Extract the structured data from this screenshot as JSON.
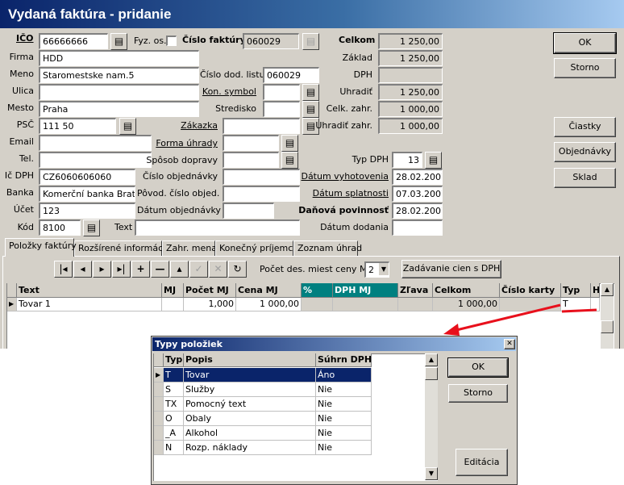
{
  "window": {
    "title": "Vydaná faktúra   -   pridanie"
  },
  "header": {
    "ico_label": "IČO",
    "ico_value": "66666666",
    "fyz_label": "Fyz. os.",
    "faktura_label": "Číslo faktúry",
    "faktura_value": "060029",
    "firma_label": "Firma",
    "firma_value": "HDD",
    "meno_label": "Meno",
    "meno_value": "Staromestske nam.5",
    "dod_list_label": "Číslo dod. listu",
    "dod_list_value": "060029",
    "ulica_label": "Ulica",
    "ulica_value": "",
    "kon_symbol_label": "Kon. symbol",
    "kon_symbol_value": "",
    "mesto_label": "Mesto",
    "mesto_value": "Praha",
    "stredisko_label": "Stredisko",
    "stredisko_value": "",
    "psc_label": "PSČ",
    "psc_value": "111 50",
    "zakazka_label": "Zákazka",
    "zakazka_value": "",
    "email_label": "Email",
    "email_value": "",
    "forma_label": "Forma úhrady",
    "forma_value": "",
    "tel_label": "Tel.",
    "tel_value": "",
    "doprava_label": "Spôsob dopravy",
    "doprava_value": "",
    "icdph_label": "Ič DPH",
    "icdph_value": "CZ6060606060",
    "obj_label": "Číslo objednávky",
    "obj_value": "",
    "banka_label": "Banka",
    "banka_value": "Komerční banka Bratisla",
    "povod_label": "Pôvod. číslo objed.",
    "povod_value": "",
    "ucet_label": "Účet",
    "ucet_value": "123",
    "datum_obj_label": "Dátum objednávky",
    "datum_obj_value": "",
    "kod_label": "Kód",
    "kod_value": "8100",
    "text_label": "Text",
    "text_value": ""
  },
  "totals": {
    "celkom_label": "Celkom",
    "celkom_value": "1 250,00",
    "zaklad_label": "Základ",
    "zaklad_value": "1 250,00",
    "dph_label": "DPH",
    "dph_value": "",
    "uhradit_label": "Uhradiť",
    "uhradit_value": "1 250,00",
    "celk_zahr_label": "Celk. zahr.",
    "celk_zahr_value": "1 000,00",
    "uhradit_zahr_label": "Uhradiť zahr.",
    "uhradit_zahr_value": "1 000,00",
    "typ_dph_label": "Typ DPH",
    "typ_dph_value": "13",
    "vyhotovenia_label": "Dátum vyhotovenia",
    "vyhotovenia_value": "28.02.2007",
    "splatnosti_label": "Dátum splatnosti",
    "splatnosti_value": "07.03.2007",
    "povinnost_label": "Daňová povinnosť",
    "povinnost_value": "28.02.2007",
    "dodania_label": "Dátum dodania",
    "dodania_value": ""
  },
  "side_buttons": {
    "ok": "OK",
    "storno": "Storno",
    "ciastky": "Čiastky",
    "objednavky": "Objednávky",
    "sklad": "Sklad"
  },
  "tabs": [
    "Položky faktúry",
    "Rozšírené informácie",
    "Zahr. mena",
    "Konečný príjemca",
    "Zoznam úhrad"
  ],
  "toolbar": {
    "decimals_label": "Počet des. miest ceny MJ",
    "decimals_value": "2",
    "zadavanie_label": "Zadávanie cien s DPH"
  },
  "grid": {
    "headers": [
      "Text",
      "MJ",
      "Počet MJ",
      "Cena MJ",
      "%",
      "DPH MJ",
      "Zľava",
      "Celkom",
      "Číslo karty",
      "Typ",
      "H"
    ],
    "row": [
      "Tovar 1",
      "",
      "1,000",
      "1 000,00",
      "",
      "",
      "",
      "1 000,00",
      "",
      "T",
      ""
    ]
  },
  "dialog": {
    "title": "Typy položiek",
    "headers": [
      "Typ",
      "Popis",
      "Súhrn DPH"
    ],
    "rows": [
      [
        "T",
        "Tovar",
        "Áno"
      ],
      [
        "S",
        "Služby",
        "Nie"
      ],
      [
        "TX",
        "Pomocný text",
        "Nie"
      ],
      [
        "O",
        "Obaly",
        "Nie"
      ],
      [
        "_A",
        "Alkohol",
        "Nie"
      ],
      [
        "N",
        "Rozp. náklady",
        "Nie"
      ]
    ],
    "ok": "OK",
    "storno": "Storno",
    "editacia": "Editácia"
  },
  "colors": {
    "title_start": "#0a246a",
    "title_end": "#a6caf0",
    "face": "#d4d0c8",
    "teal_header": "#008080",
    "annotation_red": "#e8101c"
  }
}
